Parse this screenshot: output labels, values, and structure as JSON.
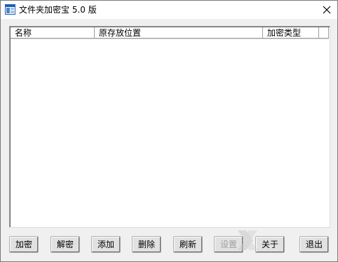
{
  "window": {
    "title": "文件夹加密宝 5.0 版"
  },
  "list": {
    "columns": [
      "名称",
      "原存放位置",
      "加密类型"
    ],
    "rows": []
  },
  "buttons": [
    {
      "label": "加密",
      "enabled": true
    },
    {
      "label": "解密",
      "enabled": true
    },
    {
      "label": "添加",
      "enabled": true
    },
    {
      "label": "删除",
      "enabled": true
    },
    {
      "label": "刷新",
      "enabled": true
    },
    {
      "label": "设置",
      "enabled": false
    },
    {
      "label": "关于",
      "enabled": true
    },
    {
      "label": "退出",
      "enabled": true
    }
  ],
  "icons": {
    "app": "app-window-icon",
    "close": "close-icon"
  },
  "colors": {
    "app_icon_blue": "#1e5fb4",
    "window_bg": "#f0f0f0"
  }
}
